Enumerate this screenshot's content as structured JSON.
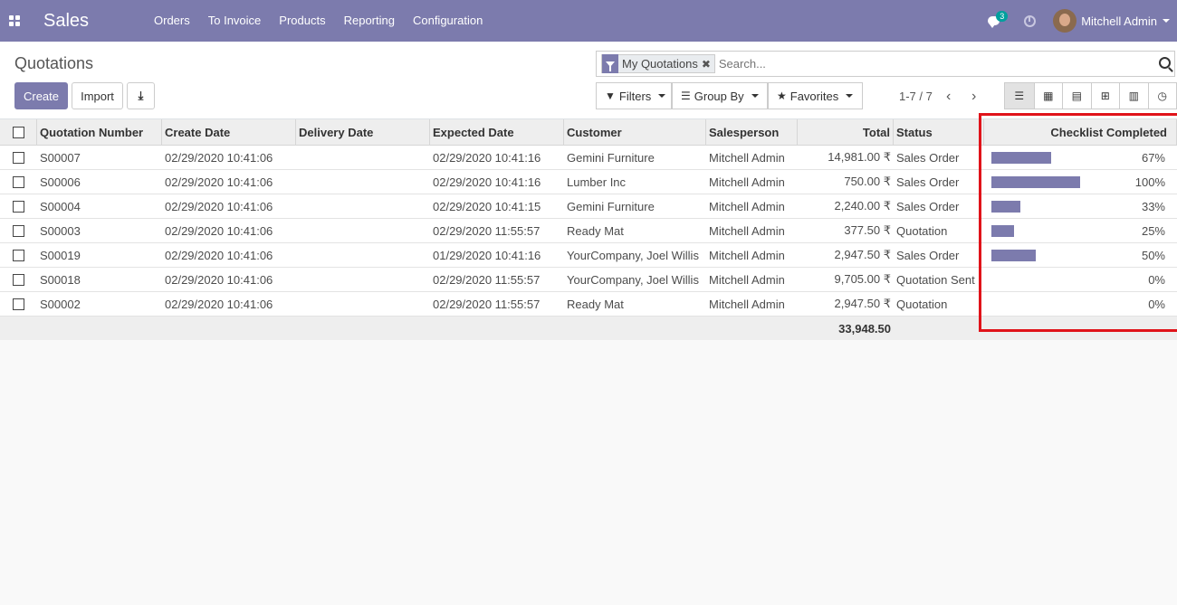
{
  "navbar": {
    "app_name": "Sales",
    "menu": [
      "Orders",
      "To Invoice",
      "Products",
      "Reporting",
      "Configuration"
    ],
    "chat_badge": "3",
    "user_name": "Mitchell Admin"
  },
  "control": {
    "breadcrumb": "Quotations",
    "create_label": "Create",
    "import_label": "Import",
    "facet_label": "My Quotations",
    "facet_remove": "✖",
    "search_placeholder": "Search...",
    "filters_label": "Filters",
    "groupby_label": "Group By",
    "favorites_label": "Favorites",
    "pager": "1-7 / 7",
    "pager_prev": "‹",
    "pager_next": "›"
  },
  "table": {
    "headers": [
      "Quotation Number",
      "Create Date",
      "Delivery Date",
      "Expected Date",
      "Customer",
      "Salesperson",
      "Total",
      "Status",
      "Checklist Completed"
    ],
    "rows": [
      {
        "number": "S00007",
        "create": "02/29/2020 10:41:06",
        "delivery": "",
        "expected": "02/29/2020 10:41:16",
        "customer": "Gemini Furniture",
        "salesperson": "Mitchell Admin",
        "total": "14,981.00 ₹",
        "status": "Sales Order",
        "checklist": "67%",
        "checklist_value": 0.67
      },
      {
        "number": "S00006",
        "create": "02/29/2020 10:41:06",
        "delivery": "",
        "expected": "02/29/2020 10:41:16",
        "customer": "Lumber Inc",
        "salesperson": "Mitchell Admin",
        "total": "750.00 ₹",
        "status": "Sales Order",
        "checklist": "100%",
        "checklist_value": 1.0
      },
      {
        "number": "S00004",
        "create": "02/29/2020 10:41:06",
        "delivery": "",
        "expected": "02/29/2020 10:41:15",
        "customer": "Gemini Furniture",
        "salesperson": "Mitchell Admin",
        "total": "2,240.00 ₹",
        "status": "Sales Order",
        "checklist": "33%",
        "checklist_value": 0.33
      },
      {
        "number": "S00003",
        "create": "02/29/2020 10:41:06",
        "delivery": "",
        "expected": "02/29/2020 11:55:57",
        "customer": "Ready Mat",
        "salesperson": "Mitchell Admin",
        "total": "377.50 ₹",
        "status": "Quotation",
        "checklist": "25%",
        "checklist_value": 0.25
      },
      {
        "number": "S00019",
        "create": "02/29/2020 10:41:06",
        "delivery": "",
        "expected": "01/29/2020 10:41:16",
        "customer": "YourCompany, Joel Willis",
        "salesperson": "Mitchell Admin",
        "total": "2,947.50 ₹",
        "status": "Sales Order",
        "checklist": "50%",
        "checklist_value": 0.5
      },
      {
        "number": "S00018",
        "create": "02/29/2020 10:41:06",
        "delivery": "",
        "expected": "02/29/2020 11:55:57",
        "customer": "YourCompany, Joel Willis",
        "salesperson": "Mitchell Admin",
        "total": "9,705.00 ₹",
        "status": "Quotation Sent",
        "checklist": "0%",
        "checklist_value": 0
      },
      {
        "number": "S00002",
        "create": "02/29/2020 10:41:06",
        "delivery": "",
        "expected": "02/29/2020 11:55:57",
        "customer": "Ready Mat",
        "salesperson": "Mitchell Admin",
        "total": "2,947.50 ₹",
        "status": "Quotation",
        "checklist": "0%",
        "checklist_value": 0
      }
    ],
    "footer_total": "33,948.50"
  },
  "colors": {
    "brand": "#7c7bad",
    "highlight": "#e0131a"
  }
}
